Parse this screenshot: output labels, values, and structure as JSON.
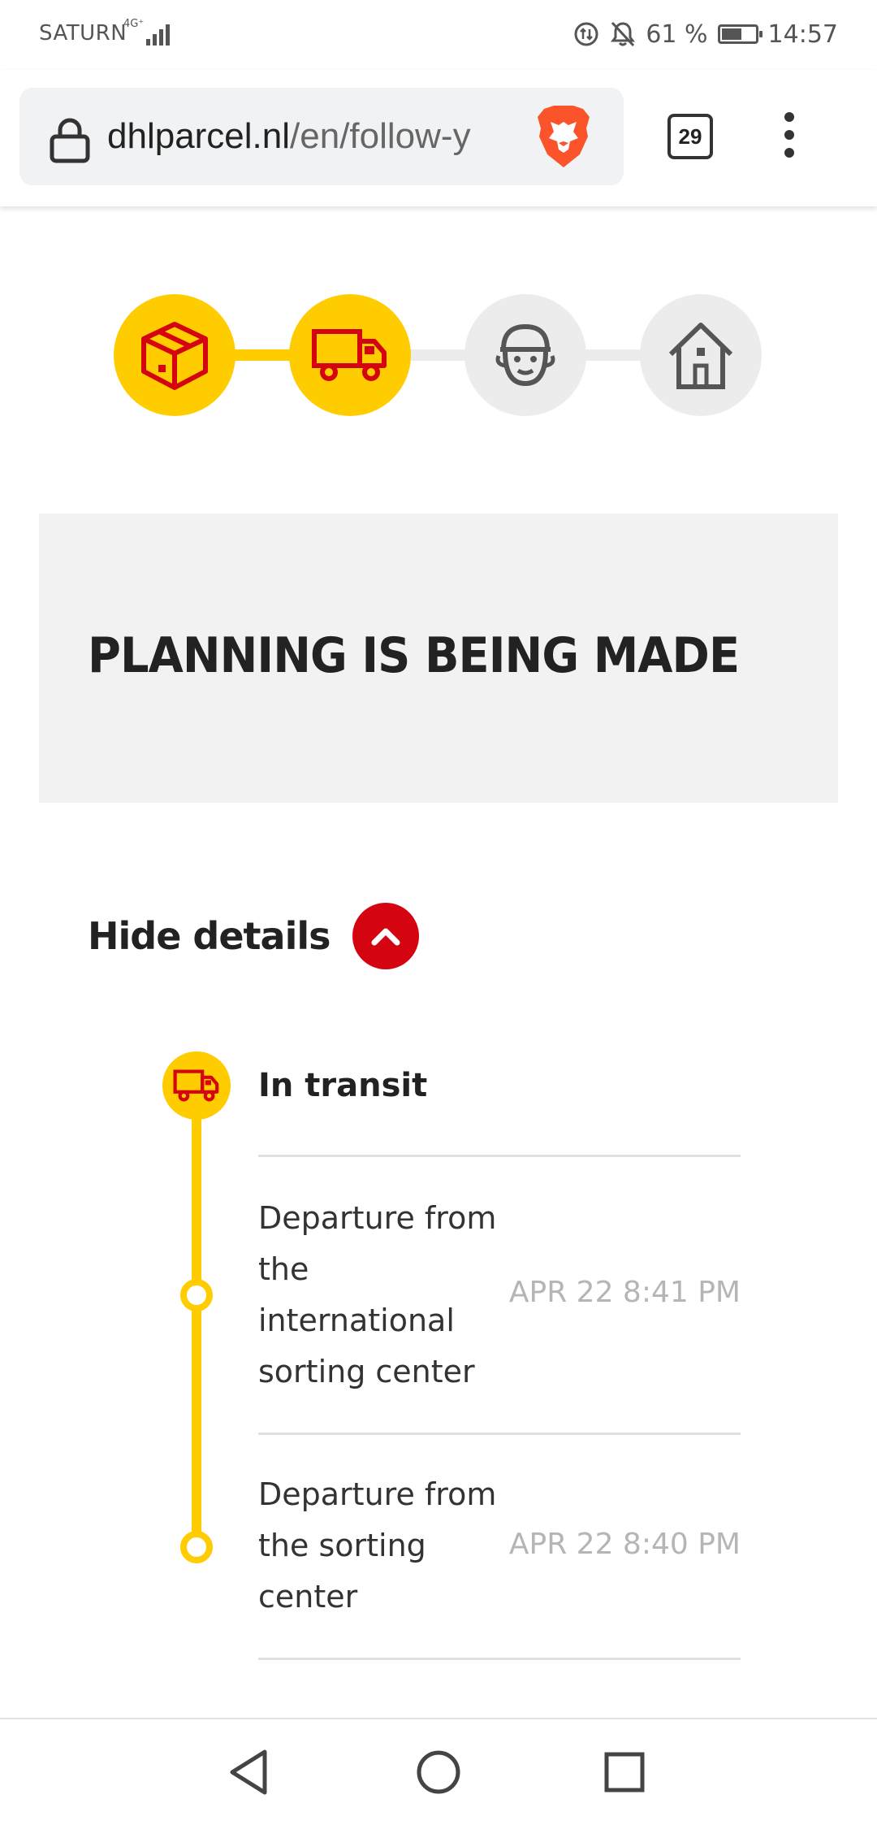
{
  "status_bar": {
    "carrier": "SATURN",
    "network_type": "4G⁺",
    "battery_percent": "61 %",
    "time": "14:57",
    "icons": [
      "signal-icon",
      "data-saver-icon",
      "bell-off-icon",
      "battery-icon"
    ]
  },
  "browser": {
    "url_domain": "dhlparcel.nl",
    "url_path": "/en/follow-y",
    "tab_count": "29",
    "icons": [
      "lock-icon",
      "brave-lion-icon",
      "tabs-icon",
      "overflow-menu-icon"
    ]
  },
  "progress": {
    "steps": [
      {
        "icon": "package-icon",
        "state": "done"
      },
      {
        "icon": "truck-icon",
        "state": "done"
      },
      {
        "icon": "courier-icon",
        "state": "pending"
      },
      {
        "icon": "home-icon",
        "state": "pending"
      }
    ]
  },
  "status": {
    "title": "PLANNING IS BEING MADE"
  },
  "details": {
    "toggle_label": "Hide details",
    "current_status": "In transit",
    "events": [
      {
        "description": "Departure from the international sorting center",
        "time": "APR 22 8:41 PM"
      },
      {
        "description": "Departure from the sorting center",
        "time": "APR 22 8:40 PM"
      }
    ]
  },
  "colors": {
    "dhl_yellow": "#ffcc00",
    "dhl_red": "#d40511",
    "panel_grey": "#f2f2f2"
  },
  "nav_bar": {
    "icons": [
      "back-icon",
      "home-circle-icon",
      "recents-icon"
    ]
  }
}
